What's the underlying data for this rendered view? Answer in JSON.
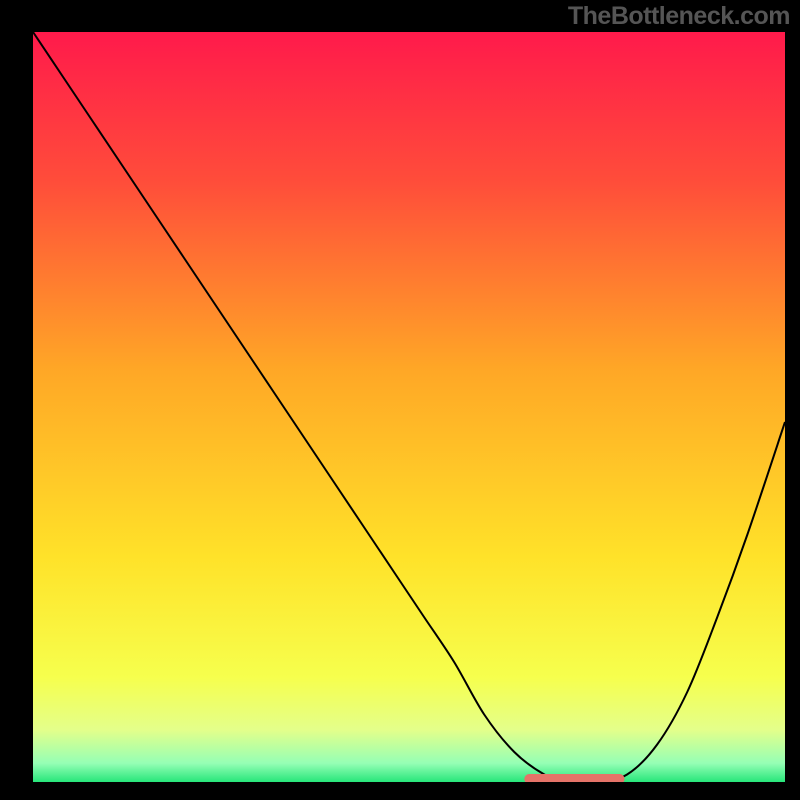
{
  "attribution": "TheBottleneck.com",
  "chart_data": {
    "type": "line",
    "title": "",
    "xlabel": "",
    "ylabel": "",
    "xlim": [
      0,
      100
    ],
    "ylim": [
      0,
      100
    ],
    "gradient_stops": [
      {
        "offset": 0.0,
        "color": "#ff1a4b"
      },
      {
        "offset": 0.2,
        "color": "#ff4d3a"
      },
      {
        "offset": 0.45,
        "color": "#ffa726"
      },
      {
        "offset": 0.7,
        "color": "#ffe229"
      },
      {
        "offset": 0.86,
        "color": "#f6ff4d"
      },
      {
        "offset": 0.93,
        "color": "#e4ff8a"
      },
      {
        "offset": 0.975,
        "color": "#95ffb5"
      },
      {
        "offset": 1.0,
        "color": "#27e67a"
      }
    ],
    "series": [
      {
        "name": "bottleneck-curve",
        "color": "#000000",
        "x": [
          0,
          4,
          8,
          12,
          16,
          20,
          24,
          28,
          32,
          36,
          40,
          44,
          48,
          52,
          56,
          60,
          64,
          68,
          71,
          75,
          79,
          83,
          87,
          91,
          95,
          100
        ],
        "y": [
          100,
          94,
          88,
          82,
          76,
          70,
          64,
          58,
          52,
          46,
          40,
          34,
          28,
          22,
          16,
          9,
          4,
          1,
          0,
          0,
          1,
          5,
          12,
          22,
          33,
          48
        ]
      },
      {
        "name": "optimal-band",
        "type": "segment",
        "color": "#e57368",
        "width": 10,
        "x": [
          66,
          78
        ],
        "y": [
          0.4,
          0.4
        ]
      }
    ]
  }
}
